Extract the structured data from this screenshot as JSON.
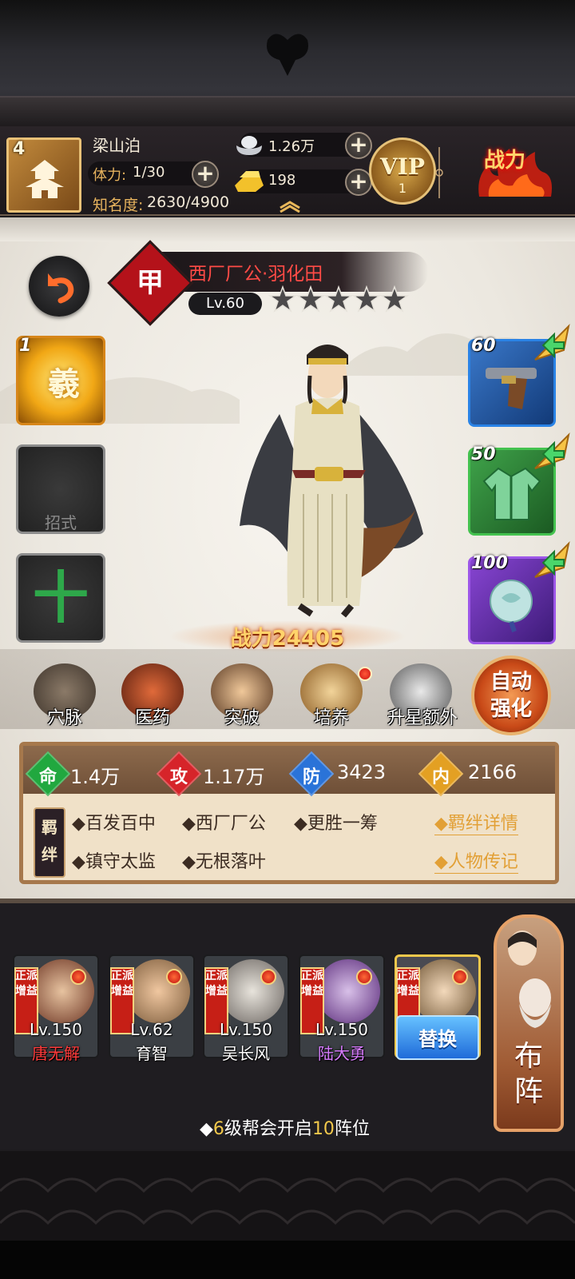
{
  "header": {
    "level": "4",
    "player_name": "梁山泊",
    "stamina_label": "体力:",
    "stamina_value": "1/30",
    "fame_label": "知名度:",
    "fame_value": "2630/4900",
    "silver": "1.26万",
    "gold": "198",
    "vip_label": "VIP",
    "vip_level": "1",
    "power_badge": "战力"
  },
  "hero": {
    "grade": "甲",
    "name": "西厂厂公·羽化田",
    "level": "Lv.60",
    "stars": 5,
    "power": "战力24405"
  },
  "left_slots": {
    "skill_level": "1",
    "skill_glyph": "羲",
    "empty_label": "招式",
    "add_symbol": "十"
  },
  "equipment": [
    {
      "level": "60",
      "icon": "pistol-icon"
    },
    {
      "level": "50",
      "icon": "armor-icon"
    },
    {
      "level": "100",
      "icon": "jade-pendant-icon"
    }
  ],
  "functions": [
    {
      "label": "穴脉",
      "icon": "meridian-icon",
      "dot": false
    },
    {
      "label": "医药",
      "icon": "medicine-icon",
      "dot": false
    },
    {
      "label": "突破",
      "icon": "breakthrough-icon",
      "dot": false
    },
    {
      "label": "培养",
      "icon": "scroll-icon",
      "dot": true
    },
    {
      "label": "升星额外",
      "icon": "star-up-icon",
      "dot": false
    }
  ],
  "auto_button": {
    "line1": "自动",
    "line2": "强化"
  },
  "stats": [
    {
      "glyph": "命",
      "value": "1.4万",
      "color": "#21a83f"
    },
    {
      "glyph": "攻",
      "value": "1.17万",
      "color": "#d6242a"
    },
    {
      "glyph": "防",
      "value": "3423",
      "color": "#2a73d8"
    },
    {
      "glyph": "内",
      "value": "2166",
      "color": "#e3a023"
    }
  ],
  "bonds": {
    "tag_line1": "羁",
    "tag_line2": "绊",
    "items": [
      "◆百发百中",
      "◆西厂厂公",
      "◆更胜一筹",
      "◆镇守太监",
      "◆无根落叶"
    ],
    "link_details": "◆羁绊详情",
    "link_biography": "◆人物传记"
  },
  "lineup": {
    "cards": [
      {
        "tag1": "正派",
        "tag2": "增益",
        "level": "Lv.150",
        "name": "唐无解",
        "name_color": "#ff3b3b"
      },
      {
        "tag1": "正派",
        "tag2": "增益",
        "level": "Lv.62",
        "name": "育智",
        "name_color": "#ffffff"
      },
      {
        "tag1": "正派",
        "tag2": "增益",
        "level": "Lv.150",
        "name": "吴长风",
        "name_color": "#ffffff"
      },
      {
        "tag1": "正派",
        "tag2": "增益",
        "level": "Lv.150",
        "name": "陆大勇",
        "name_color": "#d77cff"
      },
      {
        "tag1": "正派",
        "tag2": "增益",
        "level": "",
        "name": "",
        "name_color": "#ffffff"
      }
    ],
    "swap_label": "替换",
    "formation_label_1": "布",
    "formation_label_2": "阵",
    "unlock_prefix": "◆",
    "unlock_num1": "6",
    "unlock_mid": "级帮会开启",
    "unlock_num2": "10",
    "unlock_suffix": "阵位"
  }
}
